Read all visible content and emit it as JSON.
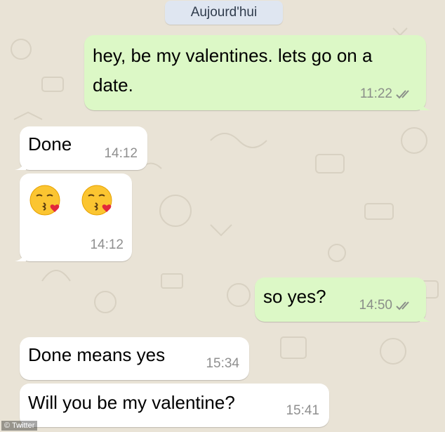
{
  "date_separator": "Aujourd'hui",
  "messages": [
    {
      "direction": "out",
      "lines": [
        "hey, be my valentines. lets go on a",
        "date."
      ],
      "time": "11:22",
      "read_ticks": "double-check-icon"
    },
    {
      "direction": "in",
      "text": "Done",
      "time": "14:12"
    },
    {
      "direction": "in",
      "emoji": [
        "kissing-heart-emoji",
        "kissing-heart-emoji"
      ],
      "time": "14:12"
    },
    {
      "direction": "out",
      "text": "so yes?",
      "time": "14:50",
      "read_ticks": "double-check-icon"
    },
    {
      "direction": "in",
      "text": "Done means yes",
      "time": "15:34"
    },
    {
      "direction": "in",
      "text": "Will you be my valentine?",
      "time": "15:41"
    }
  ],
  "watermark": "© Twitter",
  "colors": {
    "background": "#e9e3d6",
    "outgoing_bubble": "#dcf8c6",
    "incoming_bubble": "#ffffff",
    "date_pill": "#dfe6f1",
    "ticks": "#8a8e89"
  }
}
